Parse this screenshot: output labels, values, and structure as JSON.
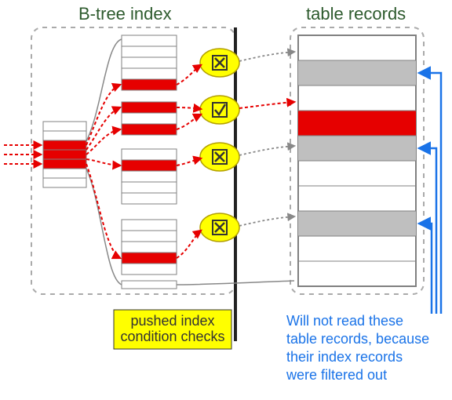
{
  "titles": {
    "left": "B-tree index",
    "right": "table records"
  },
  "caption": {
    "line1": "pushed index",
    "line2": "condition checks"
  },
  "note": {
    "line1": "Will not read these",
    "line2": "table records, because",
    "line3": "their index records",
    "line4": "were filtered out"
  },
  "colors": {
    "highlight": "#e60000",
    "gray": "#bfbfbf",
    "dashed": "#999999",
    "yellow": "#ffff00",
    "blue": "#1a73e8",
    "titleGreen": "#2d5a2d",
    "borderGray": "#808080"
  },
  "icons": {
    "check": "check-icon",
    "cross": "cross-icon"
  },
  "chart_data": {
    "type": "diagram",
    "description": "Index Condition Pushdown (ICP) optimization: B-tree index lookups are filtered by pushed index condition checks before accessing full table records, avoiding reads of filtered-out rows.",
    "root_node": {
      "rows": 7,
      "highlighted_rows": [
        2,
        3,
        4
      ]
    },
    "leaf_blocks": [
      {
        "rows": 5,
        "highlighted_rows": [
          4
        ],
        "check_result": "fail"
      },
      {
        "rows": 3,
        "highlighted_rows": [
          0,
          2
        ],
        "check_result": "pass"
      },
      {
        "rows": 5,
        "highlighted_rows": [
          1
        ],
        "check_result": "fail"
      },
      {
        "rows": 5,
        "highlighted_rows": [
          3
        ],
        "check_result": "fail"
      }
    ],
    "table_records": {
      "rows": 10,
      "gray_rows": [
        1,
        4,
        7
      ],
      "red_rows": [
        3
      ]
    },
    "arrows_saved": 3
  }
}
